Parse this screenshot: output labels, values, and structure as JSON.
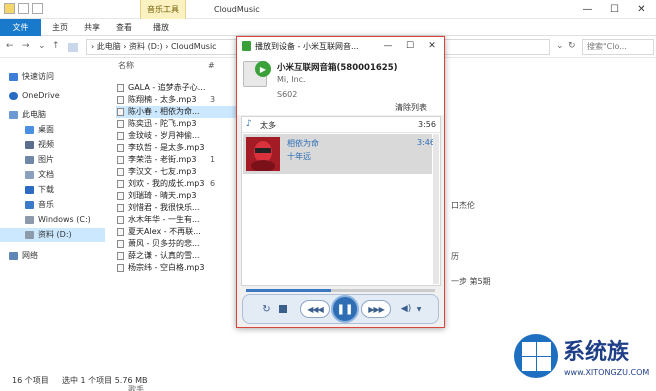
{
  "titlebar": {
    "window_title": "CloudMusic",
    "tool_tab": "音乐工具"
  },
  "ribbon": {
    "tabs": [
      "文件",
      "主页",
      "共享",
      "查看",
      "播放"
    ]
  },
  "address": {
    "path": "›  此电脑  ›  资料 (D:)  ›  CloudMusic",
    "search_placeholder": "搜索\"Clo..."
  },
  "sidebar": {
    "items": [
      {
        "label": "快速访问",
        "icon": "star-icon"
      },
      {
        "label": "OneDrive",
        "icon": "cloud-icon"
      },
      {
        "label": "此电脑",
        "icon": "computer-icon"
      },
      {
        "label": "桌面",
        "icon": "desktop-icon"
      },
      {
        "label": "视频",
        "icon": "video-icon"
      },
      {
        "label": "图片",
        "icon": "picture-icon"
      },
      {
        "label": "文档",
        "icon": "document-icon"
      },
      {
        "label": "下载",
        "icon": "download-icon"
      },
      {
        "label": "音乐",
        "icon": "music-icon"
      },
      {
        "label": "Windows (C:)",
        "icon": "drive-icon"
      },
      {
        "label": "资料 (D:)",
        "icon": "drive-icon"
      },
      {
        "label": "网络",
        "icon": "network-icon"
      }
    ],
    "selected": "资料 (D:)"
  },
  "filelist": {
    "headers": {
      "name": "名称",
      "number": "#"
    },
    "files": [
      {
        "name": "GALA - 追梦赤子心...",
        "num": ""
      },
      {
        "name": "陈翔楠 - 太多.mp3",
        "num": "3"
      },
      {
        "name": "陈小春 - 相依为命...",
        "num": ""
      },
      {
        "name": "陈奕迅 - 陀飞.mp3",
        "num": ""
      },
      {
        "name": "金玟岐 - 岁月神偷...",
        "num": ""
      },
      {
        "name": "李玖哲 - 是太多.mp3",
        "num": ""
      },
      {
        "name": "李荣浩 - 老街.mp3",
        "num": "1"
      },
      {
        "name": "李汉文 - 七友.mp3",
        "num": ""
      },
      {
        "name": "刘欢 - 我的成长.mp3",
        "num": "6"
      },
      {
        "name": "刘瑞琦 - 晴天.mp3",
        "num": ""
      },
      {
        "name": "刘惜君 - 我很快乐...",
        "num": ""
      },
      {
        "name": "水木年华 - 一生有...",
        "num": ""
      },
      {
        "name": "夏天Alex - 不再联...",
        "num": ""
      },
      {
        "name": "萧风 - 贝多芬的悲...",
        "num": ""
      },
      {
        "name": "薛之谦 - 认真的雪...",
        "num": ""
      },
      {
        "name": "杨宗纬 - 空白格.mp3",
        "num": ""
      }
    ],
    "side_texts": [
      "口杰伦",
      "历",
      "一步  第5期"
    ]
  },
  "status": {
    "count": "16 个项目",
    "selection": "选中 1 个项目  5.76 MB",
    "footer_hint": "歌手"
  },
  "player": {
    "title": "播放到设备 - 小米互联网音...",
    "device_name": "小米互联网音箱(580001625)",
    "device_maker": "Mi, Inc.",
    "device_model": "S602",
    "clear_list": "清除列表",
    "playlist": {
      "artist": "太多",
      "artist_duration": "3:56",
      "song": "相依为命",
      "album": "十年远",
      "song_duration": "3:46"
    },
    "progress": 0.45
  },
  "watermark": {
    "text": "系统族",
    "url": "www.XITONGZU.COM"
  },
  "colors": {
    "accent": "#1979ca",
    "player_border": "#d6463c",
    "play_button": "#2f6eb5",
    "selection": "#cce8ff"
  }
}
